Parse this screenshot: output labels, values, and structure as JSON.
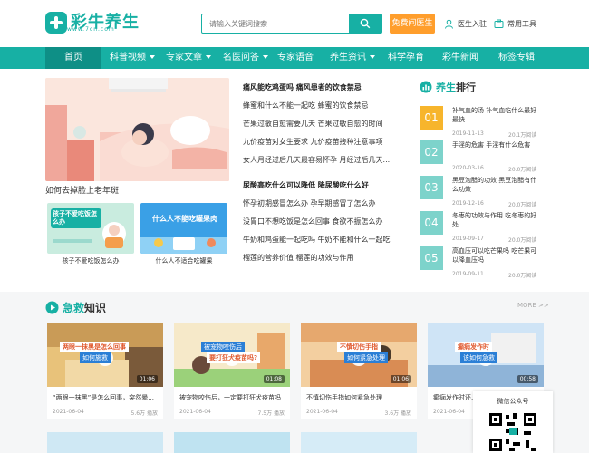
{
  "brand": {
    "name": "彩牛养生",
    "sub": "www.7cn.com",
    "color": "#17b0a4",
    "accent_orange": "#ff9e2c"
  },
  "header": {
    "search_placeholder": "请输入关键词搜索",
    "free_ask": "免费问医生",
    "doctor_join": "医生入驻",
    "tools": "常用工具"
  },
  "nav": {
    "items": [
      {
        "label": "首页",
        "active": true
      },
      {
        "label": "科普视频",
        "dropdown": true
      },
      {
        "label": "专家文章",
        "dropdown": true
      },
      {
        "label": "名医问答",
        "dropdown": true
      },
      {
        "label": "专家语音"
      },
      {
        "label": "养生资讯",
        "dropdown": true
      },
      {
        "label": "科学孕育"
      },
      {
        "label": "彩牛新闻"
      },
      {
        "label": "标签专辑"
      }
    ]
  },
  "feature": {
    "hero_caption": "如何去掉脸上老年斑",
    "thumb1_text": "孩子不爱吃饭怎么办",
    "thumb1_caption": "孩子不爱吃饭怎么办",
    "thumb2_text": "什么人不能吃罐果肉",
    "thumb2_caption": "什么人不适合吃罐果"
  },
  "news": {
    "group1": [
      "痛风能吃鸡蛋吗 痛风患者的饮食禁忌",
      "蜂蜜和什么不能一起吃 蜂蜜的饮食禁忌",
      "芒果过敏自愈需要几天 芒果过敏自愈的时间",
      "九价疫苗对女生要求 九价疫苗接种注意事项",
      "女人月经过后几天最容易怀孕 月经过后几天..."
    ],
    "group2": [
      "尿酸高吃什么可以降低 降尿酸吃什么好",
      "怀孕初期感冒怎么办 孕早期感冒了怎么办",
      "没胃口不想吃饭是怎么回事 食欲不振怎么办",
      "牛奶和鸡蛋能一起吃吗 牛奶不能和什么一起吃",
      "榴莲的营养价值 榴莲的功效与作用"
    ]
  },
  "ranking": {
    "title_accent": "养生",
    "title_rest": "排行",
    "items": [
      {
        "num": "01",
        "title": "补气血的汤 补气血吃什么最好最快",
        "date": "2019-11-13",
        "reads": "20.1万阅读",
        "color": "#f7b52c"
      },
      {
        "num": "02",
        "title": "手淫的危害 手淫有什么危害",
        "date": "2020-03-16",
        "reads": "20.0万阅读",
        "color": "#7dd3cb"
      },
      {
        "num": "03",
        "title": "黑豆泡醋的功效 黑豆泡醋有什么功效",
        "date": "2019-12-16",
        "reads": "20.0万阅读",
        "color": "#7dd3cb"
      },
      {
        "num": "04",
        "title": "冬枣的功效与作用 吃冬枣的好处",
        "date": "2019-09-17",
        "reads": "20.0万阅读",
        "color": "#7dd3cb"
      },
      {
        "num": "05",
        "title": "高血压可以吃芒果吗 吃芒果可以降血压吗",
        "date": "2019-09-11",
        "reads": "20.0万阅读",
        "color": "#7dd3cb"
      }
    ]
  },
  "section": {
    "title_accent": "急救",
    "title_rest": "知识",
    "more": "MORE >>",
    "cards": [
      {
        "overlay": "两眼一抹黑是怎么回事",
        "overlay2": "如何施救",
        "title": "“两眼一抹黑”是怎么回事，突然晕...",
        "date": "2021-06-04",
        "meta": "5.6万 播放",
        "dur": "01:06"
      },
      {
        "overlay": "被宠物咬伤后",
        "overlay2": "要打狂犬疫苗吗?",
        "title": "被宠物咬伤后，一定要打狂犬疫苗吗",
        "date": "2021-06-04",
        "meta": "7.5万 播放",
        "dur": "01:08"
      },
      {
        "overlay": "不慎切伤手指",
        "overlay2": "如何紧急处理",
        "title": "不慎切伤手指如何紧急处理",
        "date": "2021-06-04",
        "meta": "3.6万 播放",
        "dur": "01:06"
      },
      {
        "overlay": "癫痫发作时",
        "overlay2": "该如何急救",
        "title": "癫痫发作时还...",
        "date": "2021-06-04",
        "meta": "",
        "dur": "00:58"
      }
    ]
  },
  "qr": {
    "label": "微信公众号"
  }
}
